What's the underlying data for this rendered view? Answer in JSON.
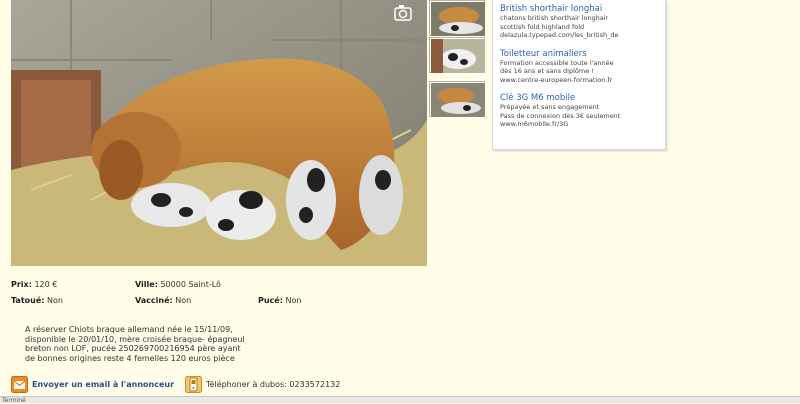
{
  "main_image": {
    "alt": "dog-nursing-puppies"
  },
  "thumbnails": [
    "thumb-1",
    "thumb-2",
    "thumb-3"
  ],
  "ads": [
    {
      "title": "British shorthair longhai",
      "lines": [
        "chatons british shorthair longhair",
        "scottish fold highland fold"
      ],
      "url": "delazula.typepad.com/les_british_de"
    },
    {
      "title": "Toiletteur animaliers",
      "lines": [
        "Formation accessible toute l'année",
        "dès 16 ans et sans diplôme !"
      ],
      "url": "www.centre-europeen-formation.fr"
    },
    {
      "title": "Clé 3G M6 mobile",
      "lines": [
        "Prépayée et sans engagement",
        "Pass de connexion dès 3€ seulement"
      ],
      "url": "www.m6mobile.fr/3G"
    }
  ],
  "details": {
    "prix_label": "Prix:",
    "prix_value": "120 €",
    "ville_label": "Ville:",
    "ville_value": "50000 Saint-Lô",
    "tatoue_label": "Tatoué:",
    "tatoue_value": "Non",
    "vaccine_label": "Vacciné:",
    "vaccine_value": "Non",
    "puce_label": "Pucé:",
    "puce_value": "Non"
  },
  "description": [
    "A réserver Chiots braque allemand née le 15/11/09,",
    "disponible le 20/01/10, mère croisée braque- épagneul",
    "breton non LOF, pucée 250269700216954 père ayant",
    "de bonnes origines reste 4 femelles 120 euros pièce"
  ],
  "contact": {
    "email_label": "Envoyer un email à l'annonceur",
    "phone_label": "Téléphoner à dubos: 0233572132"
  },
  "status_bar": {
    "text": "Terminé"
  },
  "colors": {
    "link": "#2a64b5",
    "background": "#fffde8"
  }
}
